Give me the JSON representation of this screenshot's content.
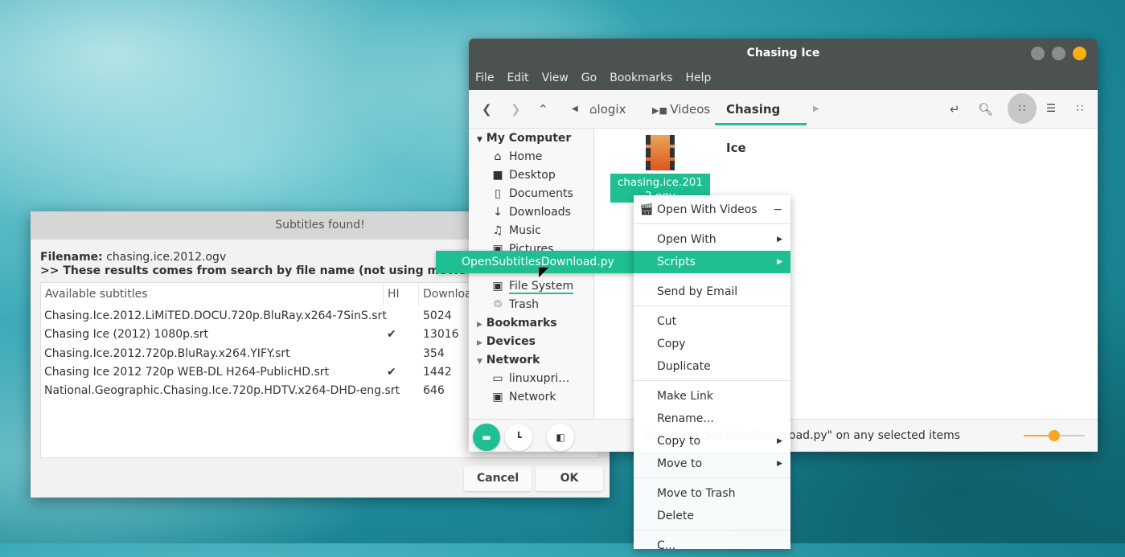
{
  "colors": {
    "accent": "#1dbf93",
    "slider": "#f5a623"
  },
  "file_manager": {
    "title": "Chasing Ice",
    "menu": [
      "File",
      "Edit",
      "View",
      "Go",
      "Bookmarks",
      "Help"
    ],
    "breadcrumbs": [
      "logix",
      "Videos",
      "Chasing Ice"
    ],
    "sidebar": {
      "my_computer": "My Computer",
      "items": [
        "Home",
        "Desktop",
        "Documents",
        "Downloads",
        "Music",
        "Pictures",
        "File System",
        "Trash"
      ],
      "bookmarks": "Bookmarks",
      "devices": "Devices",
      "network": "Network",
      "network_items": [
        "linuxupri…",
        "Network"
      ]
    },
    "file": {
      "name": "chasing.ice.2012.ogv",
      "icon": "video-file-icon"
    },
    "status_text": "Run \"OpenSubtitlesDownload.py\" on any selected items",
    "zoom_level": 0.5
  },
  "dialog": {
    "title": "Subtitles found!",
    "filename_label": "Filename:",
    "filename": "chasing.ice.2012.ogv",
    "note": ">> These results comes from search by file name (not using movie hash)",
    "columns": [
      "Available subtitles",
      "HI",
      "Downloads"
    ],
    "rows": [
      {
        "name": "Chasing.Ice.2012.LiMiTED.DOCU.720p.BluRay.x264-7SinS.srt",
        "hi": "",
        "downloads": "5024"
      },
      {
        "name": "Chasing Ice (2012) 1080p.srt",
        "hi": "✔",
        "downloads": "13016"
      },
      {
        "name": "Chasing.Ice.2012.720p.BluRay.x264.YIFY.srt",
        "hi": "",
        "downloads": "354"
      },
      {
        "name": "Chasing Ice 2012 720p WEB-DL H264-PublicHD.srt",
        "hi": "✔",
        "downloads": "1442"
      },
      {
        "name": "National.Geographic.Chasing.Ice.720p.HDTV.x264-DHD-eng.srt",
        "hi": "",
        "downloads": "646"
      }
    ],
    "cancel": "Cancel",
    "ok": "OK"
  },
  "context_menu": {
    "items": [
      "Open With Videos",
      "Open With",
      "Scripts",
      "Send by Email",
      "Cut",
      "Copy",
      "Duplicate",
      "Make Link",
      "Rename...",
      "Copy to",
      "Move to",
      "Move to Trash",
      "Delete",
      "C..."
    ],
    "minus": "−"
  },
  "scripts_submenu": {
    "item": "OpenSubtitlesDownload.py"
  }
}
